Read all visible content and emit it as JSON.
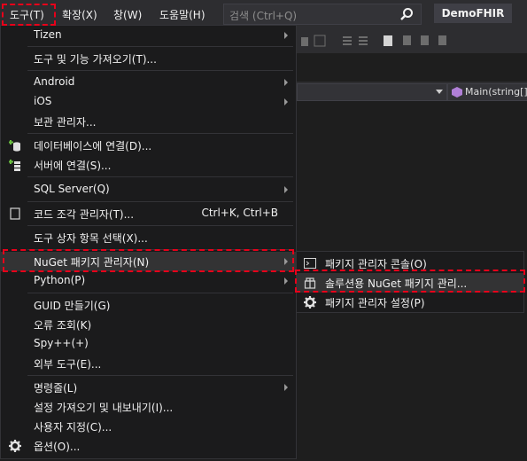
{
  "menubar": {
    "items": [
      "도구(T)",
      "확장(X)",
      "창(W)",
      "도움말(H)"
    ],
    "search_placeholder": "검색 (Ctrl+Q)",
    "project_name": "DemoFHIR"
  },
  "editor": {
    "member_combo": "Main(string[]"
  },
  "tools_menu": {
    "items": [
      {
        "label": "Tizen"
      },
      {
        "label": "도구 및 기능 가져오기(T)..."
      },
      {
        "label": "Android"
      },
      {
        "label": "iOS"
      },
      {
        "label": "보관 관리자..."
      },
      {
        "label": "데이터베이스에 연결(D)..."
      },
      {
        "label": "서버에 연결(S)..."
      },
      {
        "label": "SQL Server(Q)"
      },
      {
        "label": "코드 조각 관리자(T)...",
        "shortcut": "Ctrl+K, Ctrl+B"
      },
      {
        "label": "도구 상자 항목 선택(X)..."
      },
      {
        "label": "NuGet 패키지 관리자(N)"
      },
      {
        "label": "Python(P)"
      },
      {
        "label": "GUID 만들기(G)"
      },
      {
        "label": "오류 조회(K)"
      },
      {
        "label": "Spy++(+)"
      },
      {
        "label": "외부 도구(E)..."
      },
      {
        "label": "명령줄(L)"
      },
      {
        "label": "설정 가져오기 및 내보내기(I)..."
      },
      {
        "label": "사용자 지정(C)..."
      },
      {
        "label": "옵션(O)..."
      }
    ]
  },
  "nuget_submenu": {
    "items": [
      {
        "label": "패키지 관리자 콘솔(O)"
      },
      {
        "label": "솔루션용 NuGet 패키지 관리..."
      },
      {
        "label": "패키지 관리자 설정(P)"
      }
    ]
  },
  "colors": {
    "menu_bg": "#1b1b1c",
    "highlight": "#333334",
    "callout": "#e8001a"
  }
}
